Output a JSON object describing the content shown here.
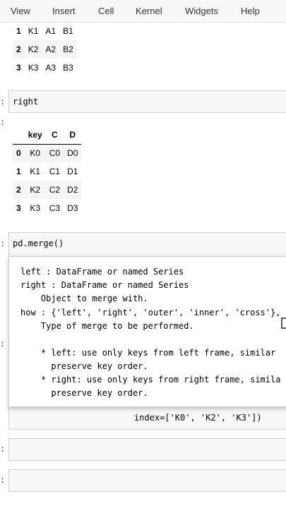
{
  "menu": {
    "view": "View",
    "insert": "Insert",
    "cell": "Cell",
    "kernel": "Kernel",
    "widgets": "Widgets",
    "help": "Help"
  },
  "top_table": {
    "rows": [
      {
        "idx": "1",
        "key": "K1",
        "a": "A1",
        "b": "B1"
      },
      {
        "idx": "2",
        "key": "K2",
        "a": "A2",
        "b": "B2"
      },
      {
        "idx": "3",
        "key": "K3",
        "a": "A3",
        "b": "B3"
      }
    ]
  },
  "cell_right": {
    "prompt": ":",
    "code": "right",
    "out_prompt": ":"
  },
  "right_table": {
    "headers": [
      "key",
      "C",
      "D"
    ],
    "rows": [
      {
        "idx": "0",
        "key": "K0",
        "c": "C0",
        "d": "D0"
      },
      {
        "idx": "1",
        "key": "K1",
        "c": "C1",
        "d": "D1"
      },
      {
        "idx": "2",
        "key": "K2",
        "c": "C2",
        "d": "D2"
      },
      {
        "idx": "3",
        "key": "K3",
        "c": "C3",
        "d": "D3"
      }
    ]
  },
  "cell_merge": {
    "prompt": ":",
    "code": "pd.merge()"
  },
  "tooltip": {
    "lines": [
      "left : DataFrame or named Series",
      "right : DataFrame or named Series",
      "    Object to merge with.",
      "how : {'left', 'right', 'outer', 'inner', 'cross'},",
      "    Type of merge to be performed.",
      "",
      "    * left: use only keys from left frame, similar",
      "      preserve key order.",
      "    * right: use only keys from right frame, simila",
      "      preserve key order."
    ]
  },
  "bg_code": "index=['K0', 'K2', 'K3'])"
}
